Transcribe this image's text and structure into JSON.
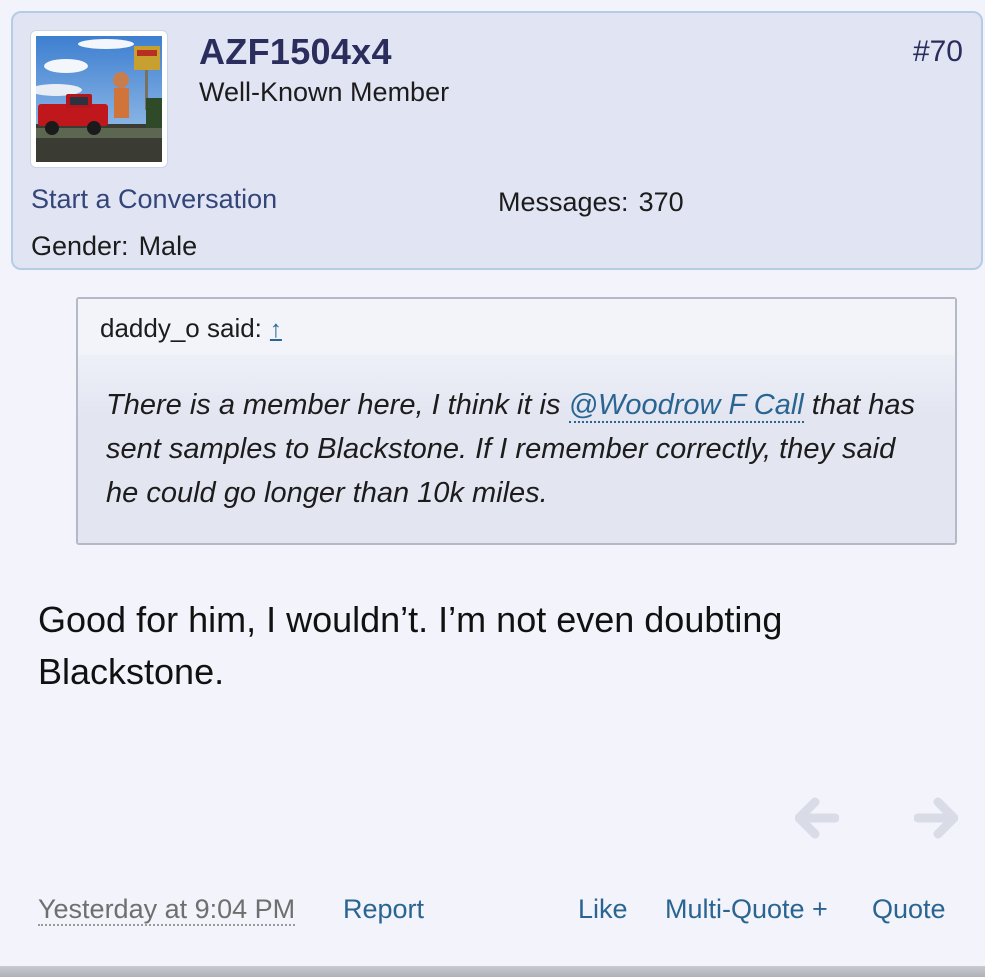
{
  "post": {
    "username": "AZF1504x4",
    "user_title": "Well-Known Member",
    "post_number": "#70",
    "start_conversation": "Start a Conversation",
    "messages_label": "Messages:",
    "messages_value": "370",
    "gender_label": "Gender:",
    "gender_value": "Male"
  },
  "quote": {
    "author_said": "daddy_o said:",
    "jump_arrow": "↑",
    "text_before": "There is a member here, I think it is ",
    "mention": "@Woodrow F Call",
    "text_after": " that has sent samples to Blackstone. If I remember correctly, they said he could go longer than 10k miles."
  },
  "message": {
    "text": "Good for him, I wouldn’t. I’m not even doubting Blackstone."
  },
  "footer": {
    "date": "Yesterday at 9:04 PM",
    "report": "Report",
    "like": "Like",
    "multi_quote": "Multi-Quote +",
    "quote": "Quote"
  },
  "icons": {
    "prev": "arrow-left-icon",
    "next": "arrow-right-icon"
  },
  "colors": {
    "link": "#2a6592",
    "username": "#2b2d5c",
    "card_bg": "#e1e5f3",
    "card_border": "#b5cde3",
    "page_bg": "#f2f3fb"
  }
}
